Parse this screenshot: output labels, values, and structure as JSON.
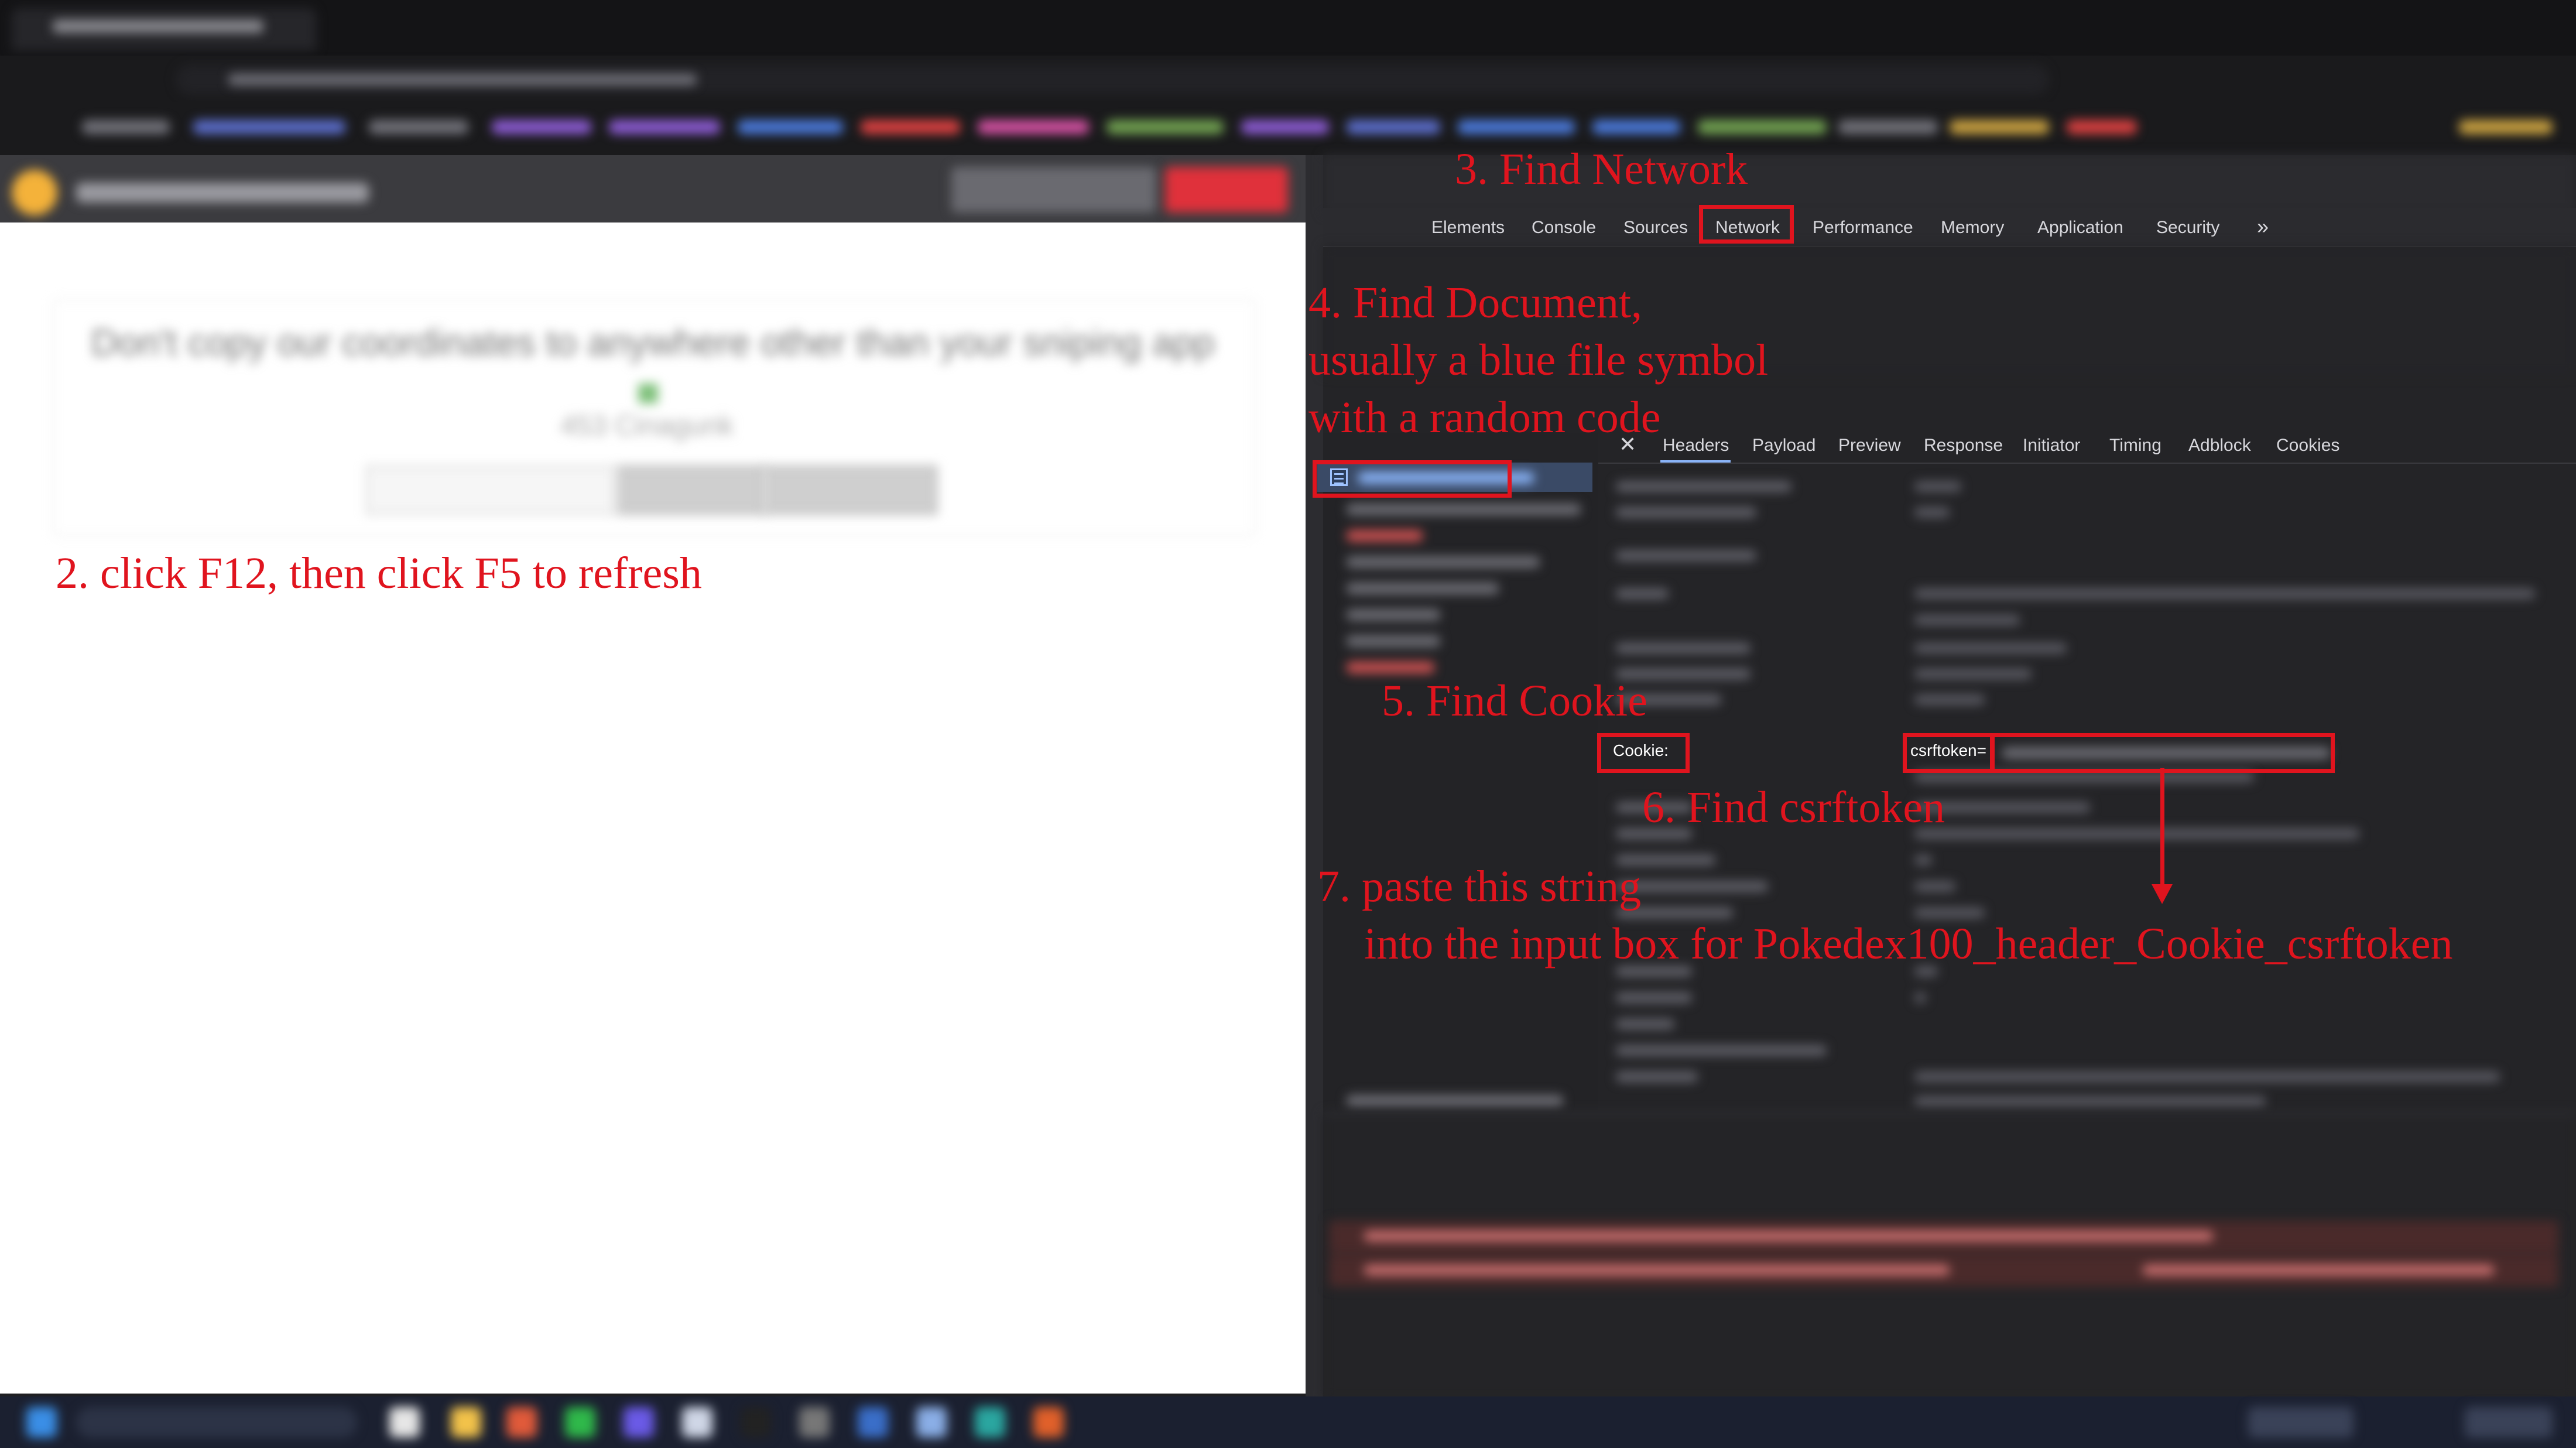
{
  "devtools": {
    "tabs": [
      "Elements",
      "Console",
      "Sources",
      "Network",
      "Performance",
      "Memory",
      "Application",
      "Security",
      "»"
    ],
    "detail_tabs": [
      "Headers",
      "Payload",
      "Preview",
      "Response",
      "Initiator",
      "Timing",
      "Adblock",
      "Cookies"
    ],
    "close_glyph": "✕",
    "cookie_label": "Cookie:",
    "csrf_label": "csrftoken="
  },
  "page": {
    "notice_text": "Don't copy our coordinates to anywhere other than your sniping app",
    "notice_sub": "453 Cinagunk"
  },
  "annotations": {
    "step2": "2. click F12, then click F5 to refresh",
    "step3": "3. Find Network",
    "step4": [
      "4. Find Document,",
      "usually a blue file symbol",
      "with a random code"
    ],
    "step5": "5. Find Cookie",
    "step6": "6. Find csrftoken",
    "step7": [
      "7. paste this string",
      "into the input box for Pokedex100_header_Cookie_csrftoken"
    ]
  },
  "colors": {
    "annotation": "#e0141e",
    "page_bg": "#ffffff",
    "devtools_bg": "#242427"
  }
}
